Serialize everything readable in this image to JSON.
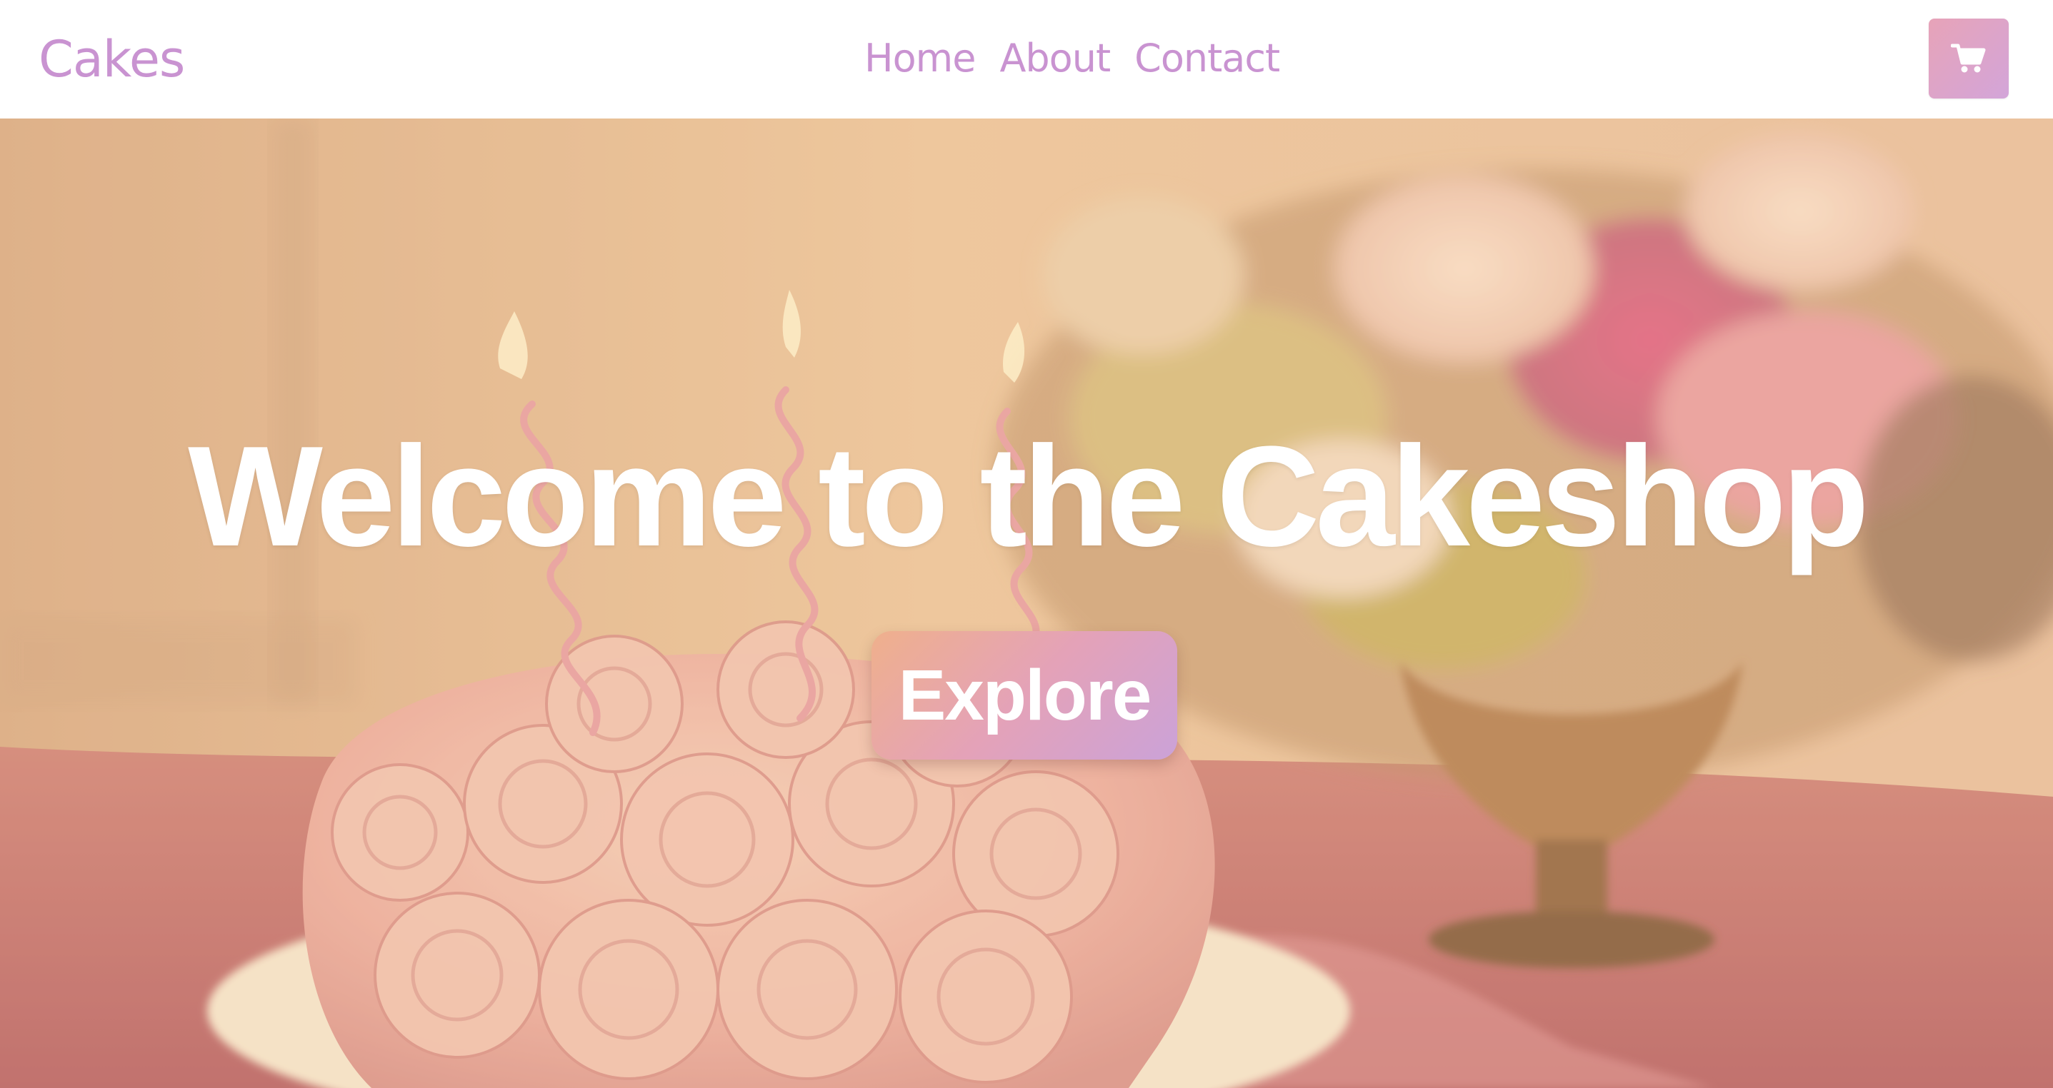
{
  "brand": {
    "name": "Cakes"
  },
  "nav": {
    "links": [
      {
        "label": "Home"
      },
      {
        "label": "About"
      },
      {
        "label": "Contact"
      }
    ]
  },
  "cart": {
    "icon": "shopping-cart-icon"
  },
  "hero": {
    "title": "Welcome to the Cakeshop",
    "cta_label": "Explore",
    "background_image": "photo of a pink rose-frosted cake with spiral candles beside a flower arrangement"
  },
  "colors": {
    "brand": "#c993d1",
    "button_gradient_start": "#efb08c",
    "button_gradient_end": "#cba2d8",
    "nav_background": "#ffffff",
    "hero_text": "#ffffff"
  }
}
